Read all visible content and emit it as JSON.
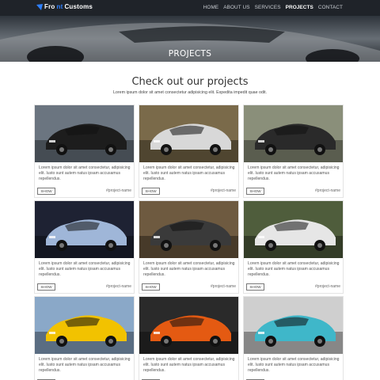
{
  "brand": {
    "name_part1": "Fro",
    "name_accent": "nt",
    "name_part2": " Customs"
  },
  "nav": [
    {
      "label": "HOME",
      "active": false
    },
    {
      "label": "ABOUT US",
      "active": false
    },
    {
      "label": "SERVICES",
      "active": false
    },
    {
      "label": "PROJECTS",
      "active": true
    },
    {
      "label": "CONTACT",
      "active": false
    }
  ],
  "hero": {
    "title": "PROJECTS"
  },
  "section": {
    "title": "Check out our projects",
    "subtitle": "Lorem ipsum dolor sit amet consectetur adipisicing elit. Expedita impedit quae odit."
  },
  "projects": [
    {
      "desc": "Lorem ipsum dolor sit amet consectetur, adipisicing elit. Iusto sunt autem natus ipsam accusamus repellendus.",
      "button": "SHOW",
      "tag": "#project-name",
      "car_color": "#1d1d1d",
      "bg_color": "#6b7580"
    },
    {
      "desc": "Lorem ipsum dolor sit amet consectetur, adipisicing elit. Iusto sunt autem natus ipsam accusamus repellendus.",
      "button": "SHOW",
      "tag": "#project-name",
      "car_color": "#d8d8d8",
      "bg_color": "#7a6a4a"
    },
    {
      "desc": "Lorem ipsum dolor sit amet consectetur, adipisicing elit. Iusto sunt autem natus ipsam accusamus repellendus.",
      "button": "SHOW",
      "tag": "#project-name",
      "car_color": "#2a2a2a",
      "bg_color": "#8a8f7a"
    },
    {
      "desc": "Lorem ipsum dolor sit amet consectetur, adipisicing elit. Iusto sunt autem natus ipsam accusamus repellendus.",
      "button": "SHOW",
      "tag": "#project-name",
      "car_color": "#9fb6d8",
      "bg_color": "#1e2233"
    },
    {
      "desc": "Lorem ipsum dolor sit amet consectetur, adipisicing elit. Iusto sunt autem natus ipsam accusamus repellendus.",
      "button": "SHOW",
      "tag": "#project-name",
      "car_color": "#3a3a3a",
      "bg_color": "#6e5a40"
    },
    {
      "desc": "Lorem ipsum dolor sit amet consectetur, adipisicing elit. Iusto sunt autem natus ipsam accusamus repellendus.",
      "button": "SHOW",
      "tag": "#project-name",
      "car_color": "#e6e6e6",
      "bg_color": "#4f5d3c"
    },
    {
      "desc": "Lorem ipsum dolor sit amet consectetur, adipisicing elit. Iusto sunt autem natus ipsam accusamus repellendus.",
      "button": "SHOW",
      "tag": "#project-name",
      "car_color": "#f2c200",
      "bg_color": "#8aa8c8"
    },
    {
      "desc": "Lorem ipsum dolor sit amet consectetur, adipisicing elit. Iusto sunt autem natus ipsam accusamus repellendus.",
      "button": "SHOW",
      "tag": "#project-name",
      "car_color": "#e45a12",
      "bg_color": "#2a2a2a"
    },
    {
      "desc": "Lorem ipsum dolor sit amet consectetur, adipisicing elit. Iusto sunt autem natus ipsam accusamus repellendus.",
      "button": "SHOW",
      "tag": "#project-name",
      "car_color": "#3fb7c9",
      "bg_color": "#cfcfcf"
    }
  ],
  "colors": {
    "navbar": "#1f2329",
    "accent": "#2e80ff"
  }
}
